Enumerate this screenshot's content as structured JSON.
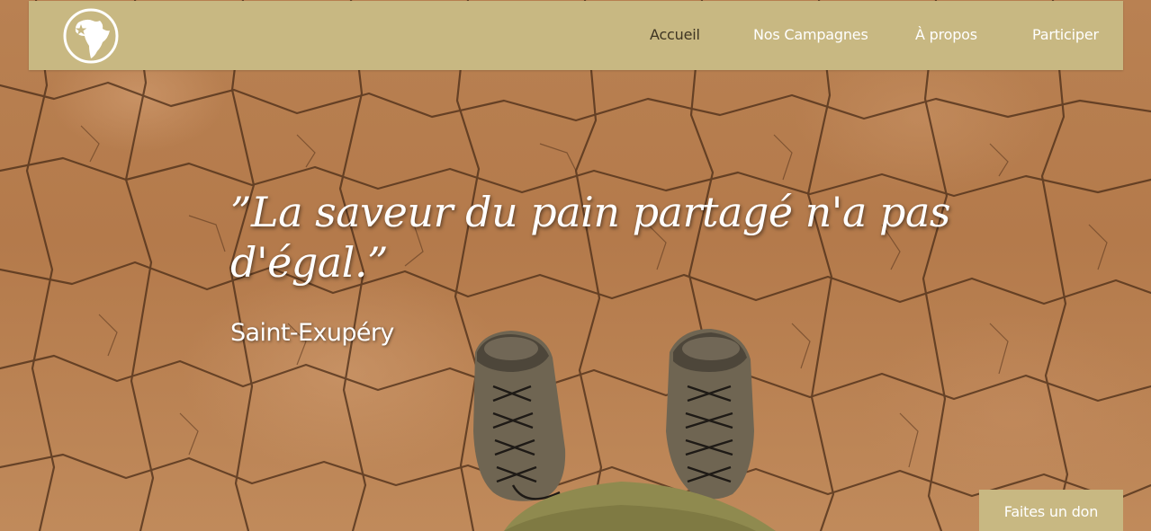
{
  "nav": {
    "logo_icon": "africa-globe-icon",
    "items": [
      {
        "label": "Accueil",
        "active": true
      },
      {
        "label": "Nos Campagnes",
        "active": false
      },
      {
        "label": "À propos",
        "active": false
      },
      {
        "label": "Participer",
        "active": false
      }
    ]
  },
  "hero": {
    "quote": "”La saveur du pain partagé n'a pas d'égal.”",
    "author": "Saint-Exupéry",
    "image_subject": "cracked-dry-earth-with-worn-sneakers"
  },
  "donate_button": {
    "label": "Faites un don"
  },
  "colors": {
    "nav_background": "#c8b882",
    "nav_active_text": "#3e3522",
    "text_light": "#ffffff",
    "earth": "#b5794b"
  }
}
